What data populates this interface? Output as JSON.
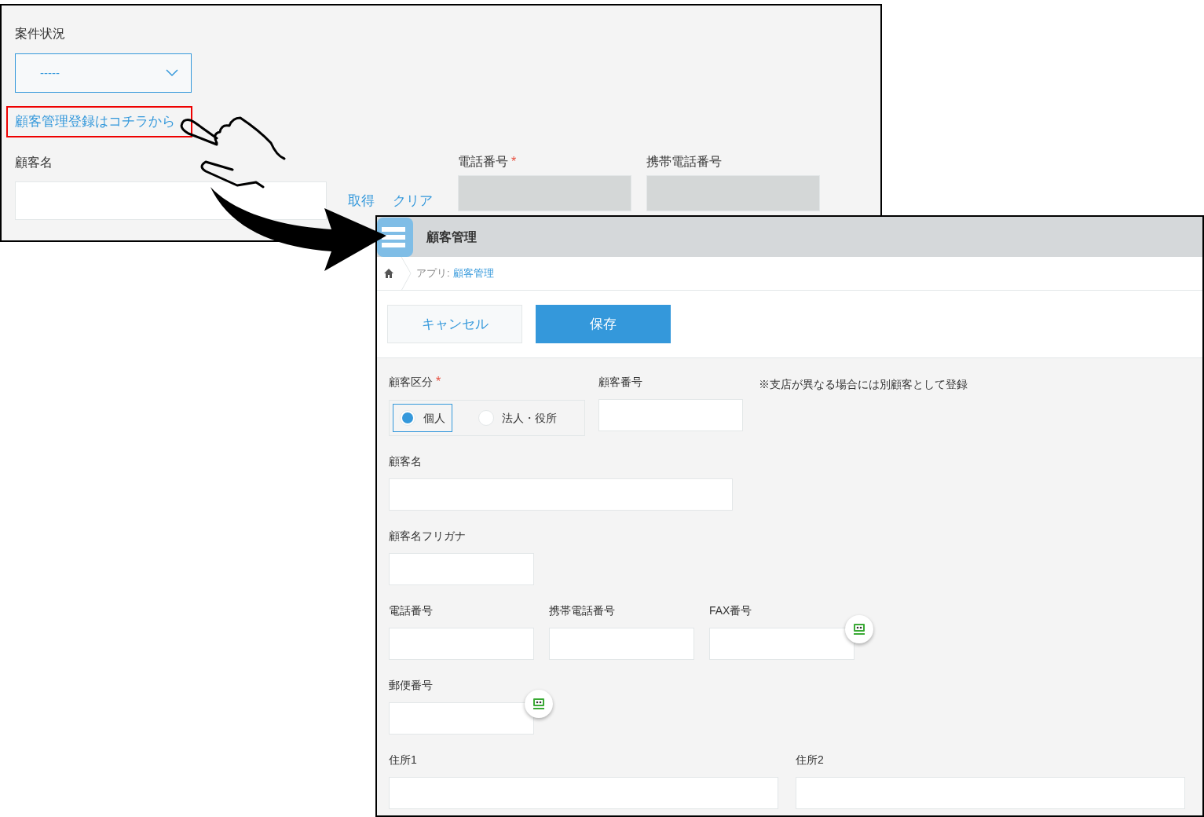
{
  "source_form": {
    "status_field": {
      "label": "案件状況",
      "value": "-----"
    },
    "link": "顧客管理登録はコチラから",
    "lookup_field": {
      "label": "顧客名",
      "buttons": [
        "取得",
        "クリア"
      ]
    },
    "copied_fields": [
      {
        "label": "電話番号",
        "required_mark": "*",
        "disabled": true
      },
      {
        "label": "携帯電話番号",
        "disabled": true
      }
    ]
  },
  "target_app": {
    "title": "顧客管理",
    "breadcrumb": {
      "prefix": "アプリ:",
      "link": "顧客管理"
    },
    "buttons": [
      {
        "label": "キャンセル",
        "kind": "secondary"
      },
      {
        "label": "保存",
        "kind": "primary"
      }
    ],
    "rows": [
      {
        "fields": [
          {
            "kind": "radio",
            "label": "顧客区分",
            "required_mark": "*",
            "options": [
              {
                "label": "個人",
                "selected": true
              },
              {
                "label": "法人・役所",
                "selected": false
              }
            ]
          },
          {
            "kind": "text",
            "label": "顧客番号",
            "badge": false
          },
          {
            "kind": "note",
            "label": "※支店が異なる場合には別顧客として登録"
          }
        ]
      },
      {
        "fields": [
          {
            "kind": "text",
            "label": "顧客名",
            "badge": false
          }
        ]
      },
      {
        "fields": [
          {
            "kind": "text",
            "label": "顧客名フリガナ",
            "badge": false
          }
        ]
      },
      {
        "fields": [
          {
            "kind": "text",
            "label": "電話番号",
            "badge": false
          },
          {
            "kind": "text",
            "label": "携帯電話番号",
            "badge": false
          },
          {
            "kind": "text",
            "label": "FAX番号",
            "badge": true
          }
        ]
      },
      {
        "fields": [
          {
            "kind": "text",
            "label": "郵便番号",
            "badge": true
          }
        ]
      },
      {
        "fields": [
          {
            "kind": "text",
            "label": "住所1",
            "badge": false
          },
          {
            "kind": "text",
            "label": "住所2",
            "badge": false
          }
        ]
      }
    ]
  }
}
